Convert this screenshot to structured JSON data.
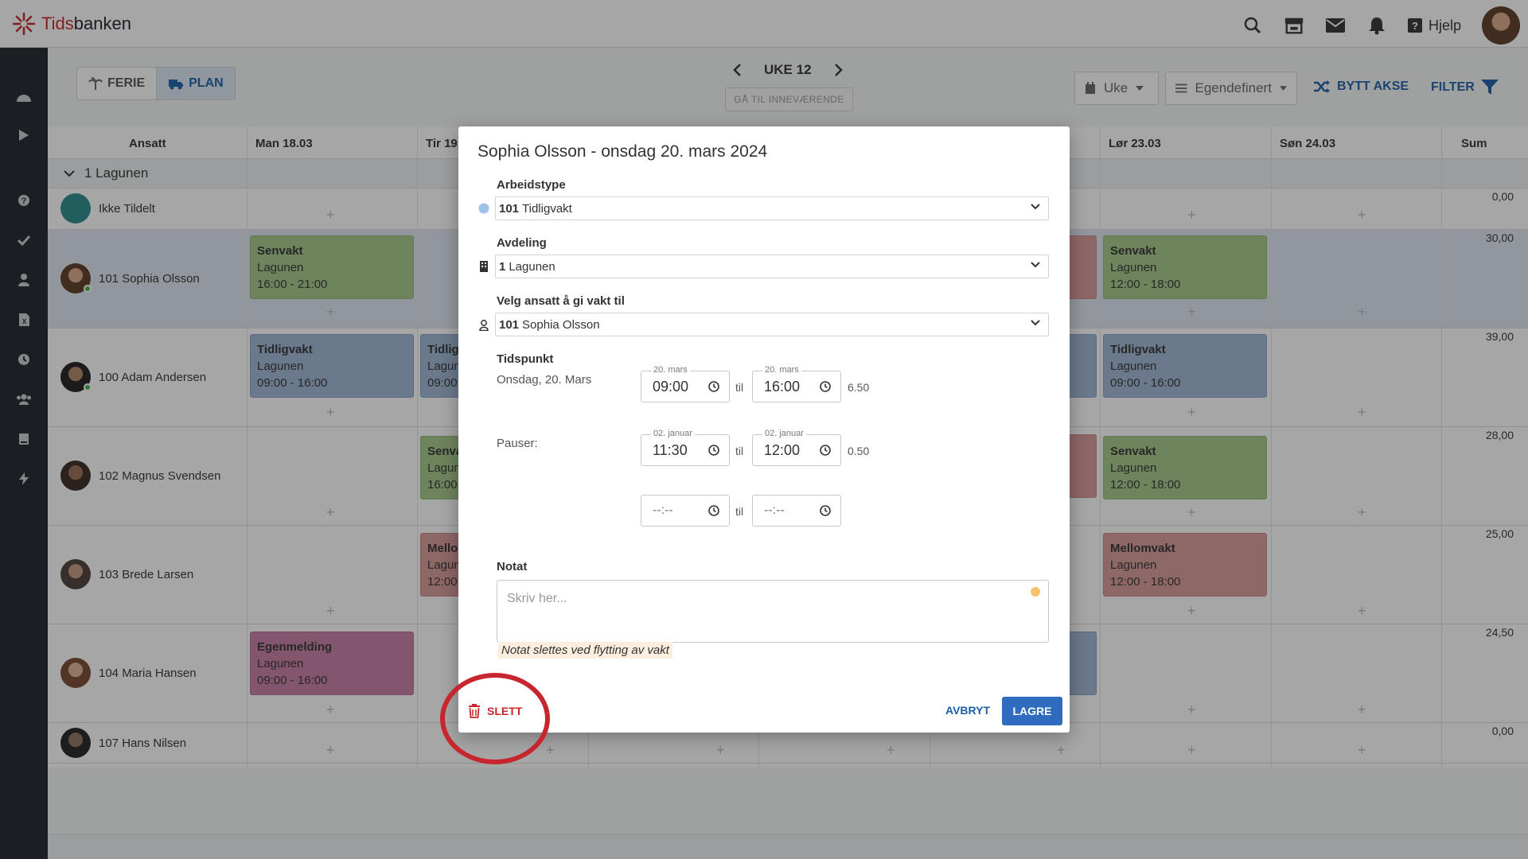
{
  "brand": {
    "name_a": "Tids",
    "name_b": "banken"
  },
  "topbar": {
    "help_label": "Hjelp"
  },
  "toolbar": {
    "ferie_label": "FERIE",
    "plan_label": "PLAN",
    "week_label": "UKE 12",
    "goto_label": "GÅ TIL INNEVÆRENDE",
    "view_value": "Uke",
    "range_value": "Egendefinert",
    "swap_axis_label": "BYTT AKSE",
    "filter_label": "FILTER"
  },
  "grid": {
    "headers": [
      "Ansatt",
      "Man 18.03",
      "Tir 19.",
      "Lør 23.03",
      "Søn 24.03",
      "Sum"
    ],
    "group_label": "1 Lagunen",
    "rows": [
      {
        "name": "Ikke Tildelt",
        "sum": "0,00"
      },
      {
        "name": "101 Sophia Olsson",
        "sum": "30,00"
      },
      {
        "name": "100 Adam Andersen",
        "sum": "39,00"
      },
      {
        "name": "102 Magnus Svendsen",
        "sum": "28,00"
      },
      {
        "name": "103 Brede Larsen",
        "sum": "25,00"
      },
      {
        "name": "104 Maria Hansen",
        "sum": "24,50"
      },
      {
        "name": "107 Hans Nilsen",
        "sum": "0,00"
      }
    ],
    "shifts": {
      "sophia_mon": {
        "type": "Senvakt",
        "dept": "Lagunen",
        "time": "16:00 - 21:00"
      },
      "sophia_sat": {
        "type": "Senvakt",
        "dept": "Lagunen",
        "time": "12:00 - 18:00"
      },
      "adam_mon": {
        "type": "Tidligvakt",
        "dept": "Lagunen",
        "time": "09:00 - 16:00"
      },
      "adam_tue": {
        "type": "Tidligv",
        "dept": "Lagun",
        "time": "09:00"
      },
      "adam_sat": {
        "type": "Tidligvakt",
        "dept": "Lagunen",
        "time": "09:00 - 16:00"
      },
      "magnus_tue": {
        "type": "Senva",
        "dept": "Lagun",
        "time": "16:00"
      },
      "magnus_sat": {
        "type": "Senvakt",
        "dept": "Lagunen",
        "time": "12:00 - 18:00"
      },
      "brede_tue": {
        "type": "Mello",
        "dept": "Lagun",
        "time": "12:00"
      },
      "brede_sat": {
        "type": "Mellomvakt",
        "dept": "Lagunen",
        "time": "12:00 - 18:00"
      },
      "maria_mon": {
        "type": "Egenmelding",
        "dept": "Lagunen",
        "time": "09:00 - 16:00"
      }
    },
    "colors": {
      "green": "#a5c98a",
      "blue": "#9fb6d3",
      "pink": "#d99a9a",
      "magenta": "#c97fa3"
    }
  },
  "modal": {
    "title": "Sophia Olsson - onsdag 20. mars 2024",
    "worktype_label": "Arbeidstype",
    "worktype_code": "101",
    "worktype_value": "Tidligvakt",
    "department_label": "Avdeling",
    "department_code": "1",
    "department_value": "Lagunen",
    "employee_label": "Velg ansatt å gi vakt til",
    "employee_code": "101",
    "employee_value": "Sophia Olsson",
    "time_label": "Tidspunkt",
    "time_date": "Onsdag, 20. Mars",
    "start_caption": "20. mars",
    "start_time": "09:00",
    "end_caption": "20. mars",
    "end_time": "16:00",
    "duration": "6.50",
    "til": "til",
    "breaks_label": "Pauser:",
    "break_start_caption": "02. januar",
    "break_start": "11:30",
    "break_end_caption": "02. januar",
    "break_end": "12:00",
    "break_duration": "0.50",
    "empty_time": "--:--",
    "note_label": "Notat",
    "note_placeholder": "Skriv her...",
    "note_warning": "Notat slettes ved flytting av vakt",
    "delete_label": "SLETT",
    "cancel_label": "AVBRYT",
    "save_label": "LAGRE",
    "accent": "#2f6cc0",
    "danger": "#c62828"
  }
}
